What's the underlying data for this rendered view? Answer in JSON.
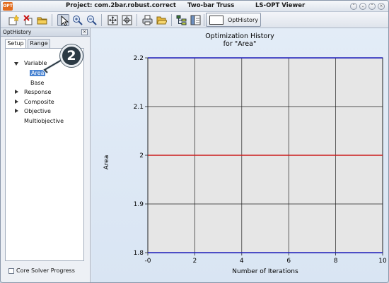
{
  "titlebar": {
    "logo": "OPT",
    "project": "Project: com.2bar.robust.correct",
    "problem": "Two-bar Truss",
    "app": "LS-OPT Viewer"
  },
  "toolbar": {
    "active_tab_label": "OptHistory"
  },
  "left_panel": {
    "header": "OptHistory",
    "tabs": [
      "Setup",
      "Range"
    ],
    "tree": {
      "variable": "Variable",
      "area": "Area",
      "base": "Base",
      "response": "Response",
      "composite": "Composite",
      "objective": "Objective",
      "multiobjective": "Multiobjective"
    },
    "checkbox_label": "Core Solver Progress"
  },
  "callout": "2",
  "chart_data": {
    "type": "line",
    "title": "Optimization History",
    "subtitle": "for \"Area\"",
    "xlabel": "Number of Iterations",
    "ylabel": "Area",
    "xlim": [
      0,
      10
    ],
    "ylim": [
      1.8,
      2.2
    ],
    "x_ticks": [
      "-0",
      "2",
      "4",
      "6",
      "8",
      "10"
    ],
    "x_tick_values": [
      0,
      2,
      4,
      6,
      8,
      10
    ],
    "y_ticks": [
      "2.2",
      "2.1",
      "2",
      "1.9",
      "1.8"
    ],
    "y_tick_values": [
      2.2,
      2.1,
      2.0,
      1.9,
      1.8
    ],
    "grid": true,
    "series": [
      {
        "role": "upper bound",
        "x": [
          0,
          10
        ],
        "values": [
          2.2,
          2.2
        ],
        "color": "#1a1ab8"
      },
      {
        "role": "value",
        "x": [
          0,
          10
        ],
        "values": [
          2.0,
          2.0
        ],
        "color": "#cc1b1b"
      },
      {
        "role": "lower bound",
        "x": [
          0,
          10
        ],
        "values": [
          1.8,
          1.8
        ],
        "color": "#1a1ab8"
      }
    ]
  }
}
